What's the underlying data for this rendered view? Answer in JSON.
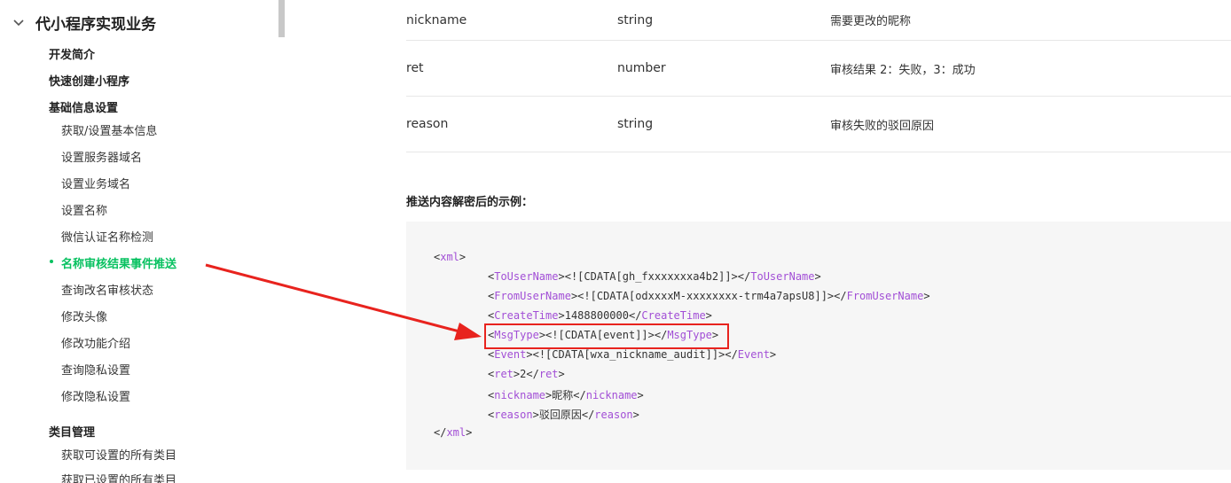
{
  "sidebar": {
    "section_title": "代小程序实现业务",
    "items": [
      {
        "label": "开发简介",
        "level": 1
      },
      {
        "label": "快速创建小程序",
        "level": 1
      },
      {
        "label": "基础信息设置",
        "level": 1
      },
      {
        "label": "获取/设置基本信息",
        "level": 2
      },
      {
        "label": "设置服务器域名",
        "level": 2
      },
      {
        "label": "设置业务域名",
        "level": 2
      },
      {
        "label": "设置名称",
        "level": 2
      },
      {
        "label": "微信认证名称检测",
        "level": 2
      },
      {
        "label": "名称审核结果事件推送",
        "level": 2,
        "active": true
      },
      {
        "label": "查询改名审核状态",
        "level": 2
      },
      {
        "label": "修改头像",
        "level": 2
      },
      {
        "label": "修改功能介绍",
        "level": 2
      },
      {
        "label": "查询隐私设置",
        "level": 2
      },
      {
        "label": "修改隐私设置",
        "level": 2
      },
      {
        "label": "类目管理",
        "level": 1
      },
      {
        "label": "获取可设置的所有类目",
        "level": 2
      },
      {
        "label": "获取已设置的所有类目",
        "level": 2
      }
    ]
  },
  "table": {
    "rows": [
      {
        "name": "nickname",
        "type": "string",
        "desc": "需要更改的昵称"
      },
      {
        "name": "ret",
        "type": "number",
        "desc": "审核结果 2：失败，3：成功"
      },
      {
        "name": "reason",
        "type": "string",
        "desc": "审核失败的驳回原因"
      }
    ]
  },
  "example_title": "推送内容解密后的示例：",
  "code": {
    "lines": [
      {
        "indent": 0,
        "open": "xml",
        "content": "",
        "close": ""
      },
      {
        "indent": 1,
        "open": "ToUserName",
        "content": "<![CDATA[gh_fxxxxxxxa4b2]]>",
        "close": "ToUserName"
      },
      {
        "indent": 1,
        "open": "FromUserName",
        "content": "<![CDATA[odxxxxM-xxxxxxxx-trm4a7apsU8]]>",
        "close": "FromUserName"
      },
      {
        "indent": 1,
        "open": "CreateTime",
        "content": "1488800000",
        "close": "CreateTime"
      },
      {
        "indent": 1,
        "open": "MsgType",
        "content": "<![CDATA[event]]>",
        "close": "MsgType"
      },
      {
        "indent": 1,
        "open": "Event",
        "content": "<![CDATA[wxa_nickname_audit]]>",
        "close": "Event"
      },
      {
        "indent": 1,
        "open": "ret",
        "content": "2",
        "close": "ret"
      },
      {
        "indent": 1,
        "open": "nickname",
        "content": "昵称",
        "close": "nickname"
      },
      {
        "indent": 1,
        "open": "reason",
        "content": "驳回原因",
        "close": "reason"
      },
      {
        "indent": 0,
        "open": "",
        "content": "",
        "close": "xml"
      }
    ]
  },
  "colors": {
    "accent": "#07c160",
    "annotation": "#e8231e",
    "xml_tag": "#a24fd6",
    "code_bg": "#f6f6f6"
  },
  "icons": {
    "section_toggle": "chevron-down-icon"
  }
}
